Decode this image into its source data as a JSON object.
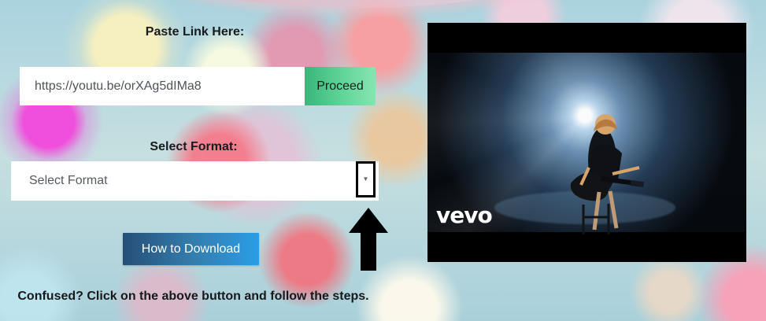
{
  "form": {
    "paste_label": "Paste Link Here:",
    "url_value": "https://youtu.be/orXAg5dIMa8",
    "proceed_label": "Proceed",
    "format_label": "Select Format:",
    "format_selected": "Select Format",
    "format_arrow": "▼"
  },
  "help": {
    "button_label": "How to Download",
    "message": "Confused? Click on the above button and follow the steps."
  },
  "video": {
    "logo": "vevo"
  },
  "icons": {
    "dropdown": "chevron-down-icon",
    "callout": "arrow-up-icon"
  },
  "colors": {
    "proceed_green": "#62d59a",
    "help_blue": "#2b9de6",
    "callout_black": "#000000"
  }
}
